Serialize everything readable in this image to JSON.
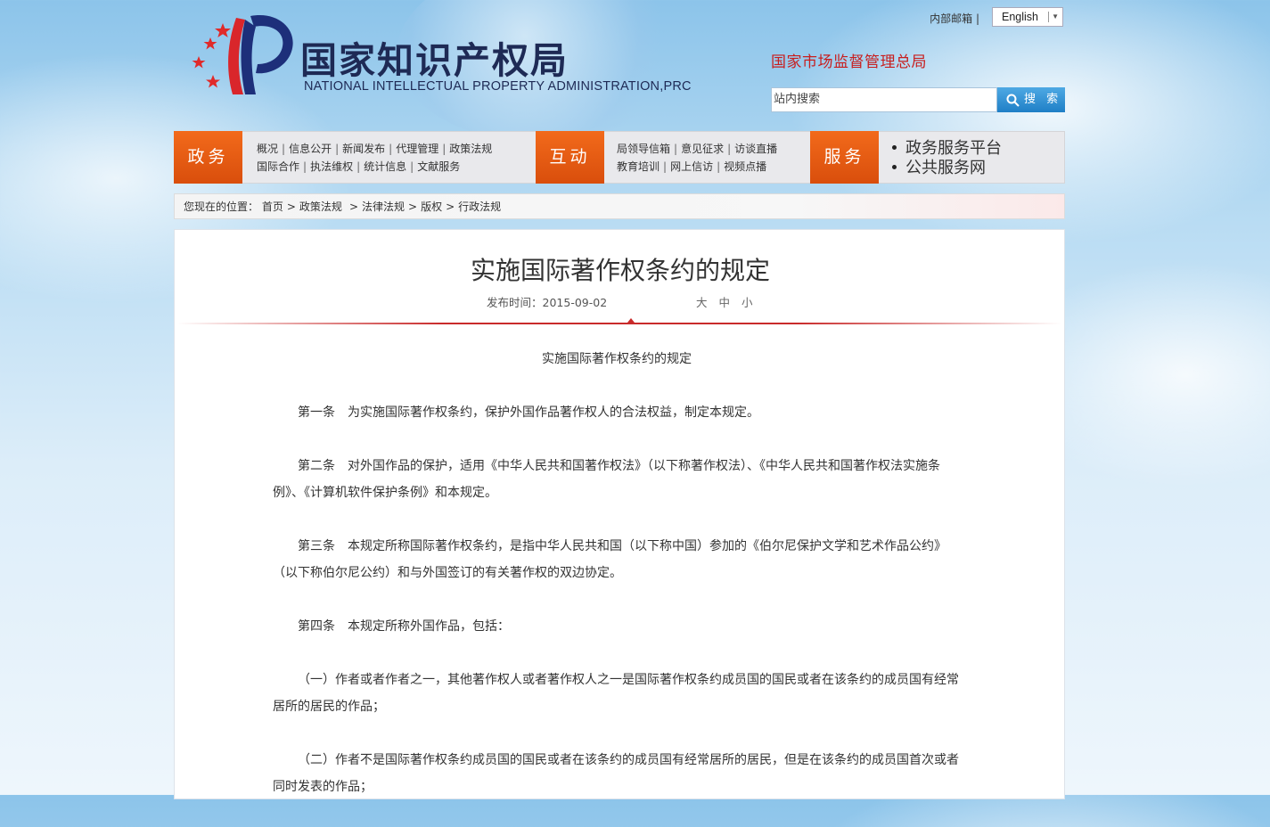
{
  "header": {
    "logo_cn": "国家知识产权局",
    "logo_en": "NATIONAL INTELLECTUAL PROPERTY ADMINISTRATION,PRC",
    "internal_mail": "内部邮箱",
    "language_selected": "English",
    "parent_agency": "国家市场监督管理总局",
    "search_placeholder": "站内搜索",
    "search_button": "搜 索"
  },
  "nav": {
    "gov_label": "政务",
    "gov_links_row1": [
      "概况",
      "信息公开",
      "新闻发布",
      "代理管理",
      "政策法规"
    ],
    "gov_links_row2": [
      "国际合作",
      "执法维权",
      "统计信息",
      "文献服务"
    ],
    "interact_label": "互动",
    "interact_links_row1": [
      "局领导信箱",
      "意见征求",
      "访谈直播"
    ],
    "interact_links_row2": [
      "教育培训",
      "网上信访",
      "视频点播"
    ],
    "service_label": "服务",
    "service_links": [
      "政务服务平台",
      "公共服务网"
    ]
  },
  "breadcrumb": {
    "prefix": "您现在的位置：",
    "items": [
      "首页",
      "政策法规",
      "法律法规",
      "版权",
      "行政法规"
    ]
  },
  "article": {
    "title": "实施国际著作权条约的规定",
    "publish_label": "发布时间：",
    "publish_date": "2015-09-02",
    "font_sizes": [
      "大",
      "中",
      "小"
    ],
    "paragraphs": [
      "实施国际著作权条约的规定",
      "第一条　为实施国际著作权条约，保护外国作品著作权人的合法权益，制定本规定。",
      "第二条　对外国作品的保护，适用《中华人民共和国著作权法》（以下称著作权法）、《中华人民共和国著作权法实施条例》、《计算机软件保护条例》和本规定。",
      "第三条　本规定所称国际著作权条约，是指中华人民共和国（以下称中国）参加的《伯尔尼保护文学和艺术作品公约》（以下称伯尔尼公约）和与外国签订的有关著作权的双边协定。",
      "第四条　本规定所称外国作品，包括：",
      "（一）作者或者作者之一，其他著作权人或者著作权人之一是国际著作权条约成员国的国民或者在该条约的成员国有经常居所的居民的作品；",
      "（二）作者不是国际著作权条约成员国的国民或者在该条约的成员国有经常居所的居民，但是在该条约的成员国首次或者同时发表的作品；"
    ]
  },
  "colors": {
    "nav_orange": "#e55a12",
    "brand_navy": "#1e2a55",
    "accent_red": "#c81e1e",
    "search_blue": "#2b8ad0"
  }
}
